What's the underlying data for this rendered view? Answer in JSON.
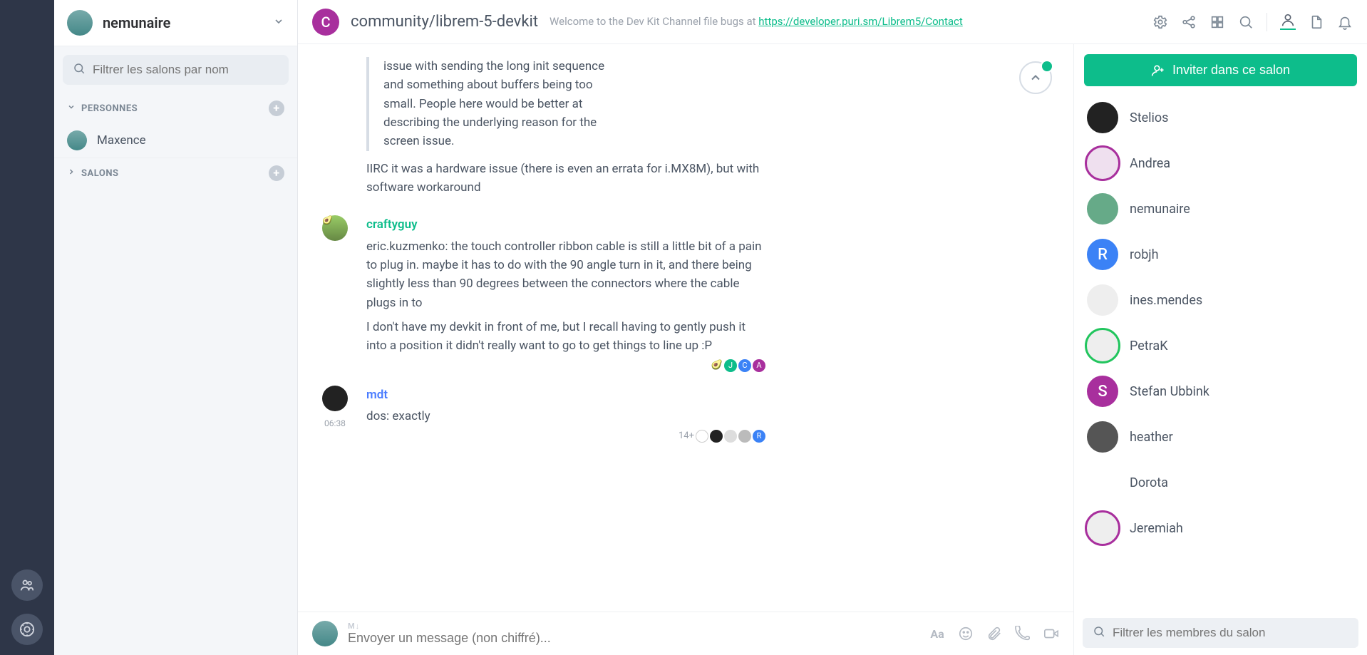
{
  "user": {
    "name": "nemunaire"
  },
  "sidebar": {
    "filter_placeholder": "Filtrer les salons par nom",
    "section_people": "PERSONNES",
    "section_rooms": "SALONS",
    "people": [
      {
        "name": "Maxence"
      }
    ]
  },
  "room": {
    "avatar_letter": "C",
    "title": "community/librem-5-devkit",
    "topic_prefix": "Welcome to the Dev Kit Channel file bugs at ",
    "topic_link_text": "https://developer.puri.sm/Librem5/Contact",
    "topic_link_href": "https://developer.puri.sm/Librem5/Contact"
  },
  "messages": {
    "quote_text": "issue with sending the long init sequence and something about buffers being too small. People here would be better at describing the underlying reason for the screen issue.",
    "reply_text": "IIRC it was a hardware issue (there is even an errata for i.MX8M), but with software workaround",
    "craftyguy": {
      "name": "craftyguy",
      "color": "#0dbd8b",
      "p1": "eric.kuzmenko: the touch controller ribbon cable is still a little bit of a pain to plug in. maybe it has to do with the 90 angle turn in it, and there being slightly less than 90 degrees between the connectors where the cable plugs in to",
      "p2": "I don't have my devkit in front of me, but I recall having to gently push it into a position it didn't really want to go to get things to line up :P"
    },
    "mdt": {
      "name": "mdt",
      "color": "#4a7cff",
      "time": "06:38",
      "text": "dos: exactly",
      "read_count": "14+"
    }
  },
  "composer": {
    "placeholder": "Envoyer un message (non chiffré)...",
    "markdown_hint": "M↓"
  },
  "members": {
    "invite_label": "Inviter dans ce salon",
    "filter_placeholder": "Filtrer les membres du salon",
    "list": [
      {
        "name": "Stelios",
        "bg": "#222",
        "letter": ""
      },
      {
        "name": "Andrea",
        "bg": "#efe0ef",
        "ring": "#a82f9d",
        "letter": ""
      },
      {
        "name": "nemunaire",
        "bg": "#6a8",
        "letter": ""
      },
      {
        "name": "robjh",
        "bg": "#3b82f6",
        "letter": "R"
      },
      {
        "name": "ines.mendes",
        "bg": "#eee",
        "letter": ""
      },
      {
        "name": "PetraK",
        "bg": "#eee",
        "ring": "#22c55e",
        "letter": ""
      },
      {
        "name": "Stefan Ubbink",
        "bg": "#a82f9d",
        "letter": "S"
      },
      {
        "name": "heather",
        "bg": "#555",
        "letter": ""
      },
      {
        "name": "Dorota",
        "bg": "#fff",
        "letter": ""
      },
      {
        "name": "Jeremiah",
        "bg": "#eee",
        "ring": "#a82f9d",
        "letter": ""
      }
    ]
  }
}
